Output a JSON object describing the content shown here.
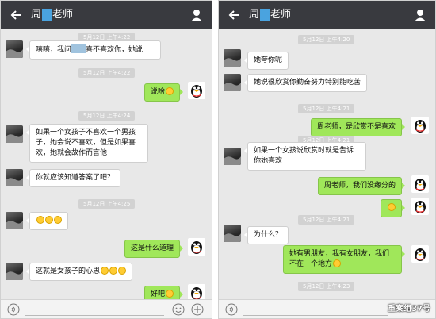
{
  "left": {
    "title_prefix": "周",
    "title_suffix": "老师",
    "messages": {
      "m1": {
        "part1": "嘻嘻，我问",
        "part2": "喜不喜欢你，她说"
      },
      "m2": "说啥",
      "m3": "如果一个女孩子不喜欢一个男孩子，她会说不喜欢，但是如果喜欢，她就会故作而言他",
      "m4": "你就应该知道答案了吧？",
      "m6": "这是什么道理",
      "m7": "这就是女孩子的心思",
      "m8": "好吧"
    },
    "timestamps": [
      "5月12日 上午4:22",
      "5月12日 上午4:22",
      "5月12日 上午4:24",
      "5月12日 上午4:25"
    ]
  },
  "right": {
    "title_prefix": "周",
    "title_suffix": "老师",
    "messages": {
      "r1": "她夸你呢",
      "r2": "她说很欣赏你勤奋努力特别能吃苦",
      "r3": "周老师，是欣赏不是喜欢",
      "r4": "如果一个女孩说欣赏时就是告诉你她喜欢",
      "r5": "周老师，我们没缘分的",
      "r7": "为什么？",
      "r8": "她有男朋友，我有女朋友，我们不在一个地方"
    },
    "timestamps": [
      "5月12日 上午4:20",
      "5月12日 上午4:21",
      "5月12日 上午4:21",
      "5月12日 上午4:21",
      "5月12日 上午4:23"
    ]
  },
  "watermark": "重案组37号",
  "icons": [
    "back-arrow-icon",
    "contact-icon",
    "voice-icon",
    "emoji-icon",
    "plus-icon",
    "qq-penguin-icon",
    "smiley-emoji-icon"
  ],
  "colors": {
    "topbar": "#393a3f",
    "chat_bg": "#e8e8e8",
    "bubble_out": "#a0e75a",
    "bubble_in": "#ffffff"
  }
}
